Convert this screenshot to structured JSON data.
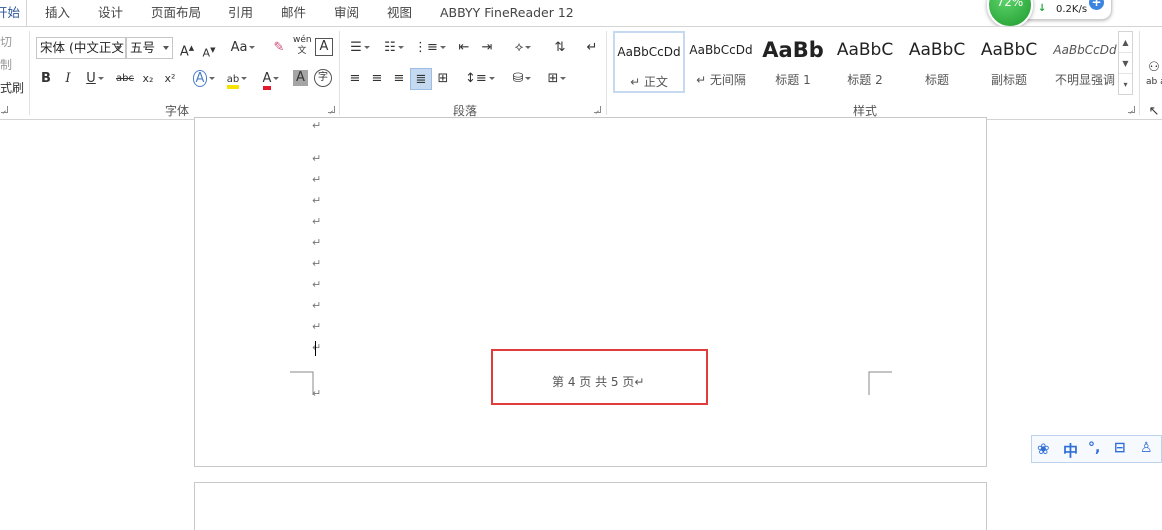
{
  "tabs": [
    {
      "id": "home",
      "label": "开始",
      "active": true
    },
    {
      "id": "insert",
      "label": "插入"
    },
    {
      "id": "design",
      "label": "设计"
    },
    {
      "id": "layout",
      "label": "页面布局"
    },
    {
      "id": "references",
      "label": "引用"
    },
    {
      "id": "mailings",
      "label": "邮件"
    },
    {
      "id": "review",
      "label": "审阅"
    },
    {
      "id": "view",
      "label": "视图"
    },
    {
      "id": "abbyy",
      "label": "ABBYY FineReader 12"
    }
  ],
  "clipboard": {
    "cut": "切",
    "copy": "制",
    "format_painter": "式刷"
  },
  "font": {
    "name": "宋体 (中文正文",
    "size": "五号",
    "grow_label": "A",
    "shrink_label": "A",
    "case_label": "Aa",
    "group_label": "字体",
    "bold": "B",
    "italic": "I",
    "underline": "U",
    "strike": "abc",
    "subscript": "x₂",
    "superscript": "x²",
    "effects": "A",
    "highlight": "ab",
    "color": "A",
    "shading": "A",
    "enclose": "字",
    "phonetic": "wén",
    "phonetic_sub": "文",
    "border": "A"
  },
  "paragraph": {
    "group_label": "段落"
  },
  "styles": {
    "group_label": "样式",
    "items": [
      {
        "sample": "AaBbCcDd",
        "name": "↵ 正文",
        "active": true
      },
      {
        "sample": "AaBbCcDd",
        "name": "↵ 无间隔"
      },
      {
        "sample": "AaBb",
        "name": "标题 1"
      },
      {
        "sample": "AaBbC",
        "name": "标题 2"
      },
      {
        "sample": "AaBbC",
        "name": "标题"
      },
      {
        "sample": "AaBbC",
        "name": "副标题"
      },
      {
        "sample": "AaBbCcDd",
        "name": "不明显强调"
      }
    ]
  },
  "right_tools": {
    "label": "ab ac"
  },
  "widget": {
    "percent": "72%",
    "speed": "0.2K/s",
    "plus": "+"
  },
  "document": {
    "paragraph_mark": "↵",
    "footer": "第 4 页  共 5 页↵",
    "highlight_color": "#e03c3c"
  },
  "ime": {
    "label": "中",
    "punct": "°,"
  }
}
